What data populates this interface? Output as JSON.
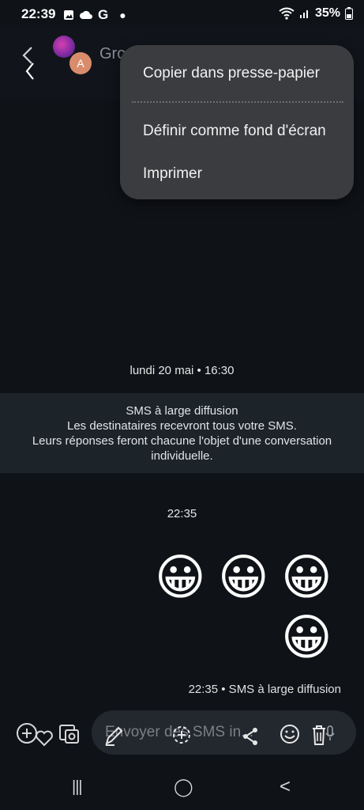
{
  "status_bar": {
    "time": "22:39",
    "battery": "35%",
    "icons": [
      "image-icon",
      "cloud-icon",
      "google-icon",
      "dot-icon",
      "wifi-icon",
      "signal-icon",
      "battery-icon"
    ]
  },
  "header": {
    "title": "Gro",
    "avatar_letter": "A"
  },
  "menu": {
    "items": [
      {
        "label": "Copier dans presse-papier"
      },
      {
        "label": "Définir comme fond d'écran"
      },
      {
        "label": "Imprimer"
      }
    ]
  },
  "chat": {
    "date_header": "lundi 20 mai • 16:30",
    "broadcast_notice": {
      "line1": "SMS à large diffusion",
      "line2": "Les destinataires recevront tous votre SMS.",
      "line3": "Leurs réponses feront chacune l'objet d'une conversation",
      "line4": "individuelle."
    },
    "time_header": "22:35",
    "emojis": [
      "😀",
      "😀",
      "😀",
      "😀"
    ],
    "message_meta": "22:35 • SMS à large diffusion"
  },
  "composer": {
    "placeholder": "Envoyer des SMS in..."
  },
  "nav": {
    "recents": "|||",
    "home": "◯",
    "back": "<"
  },
  "colors": {
    "background": "#0f1217",
    "menu": "#3b3c40",
    "broadcast_band": "#1c2429"
  }
}
